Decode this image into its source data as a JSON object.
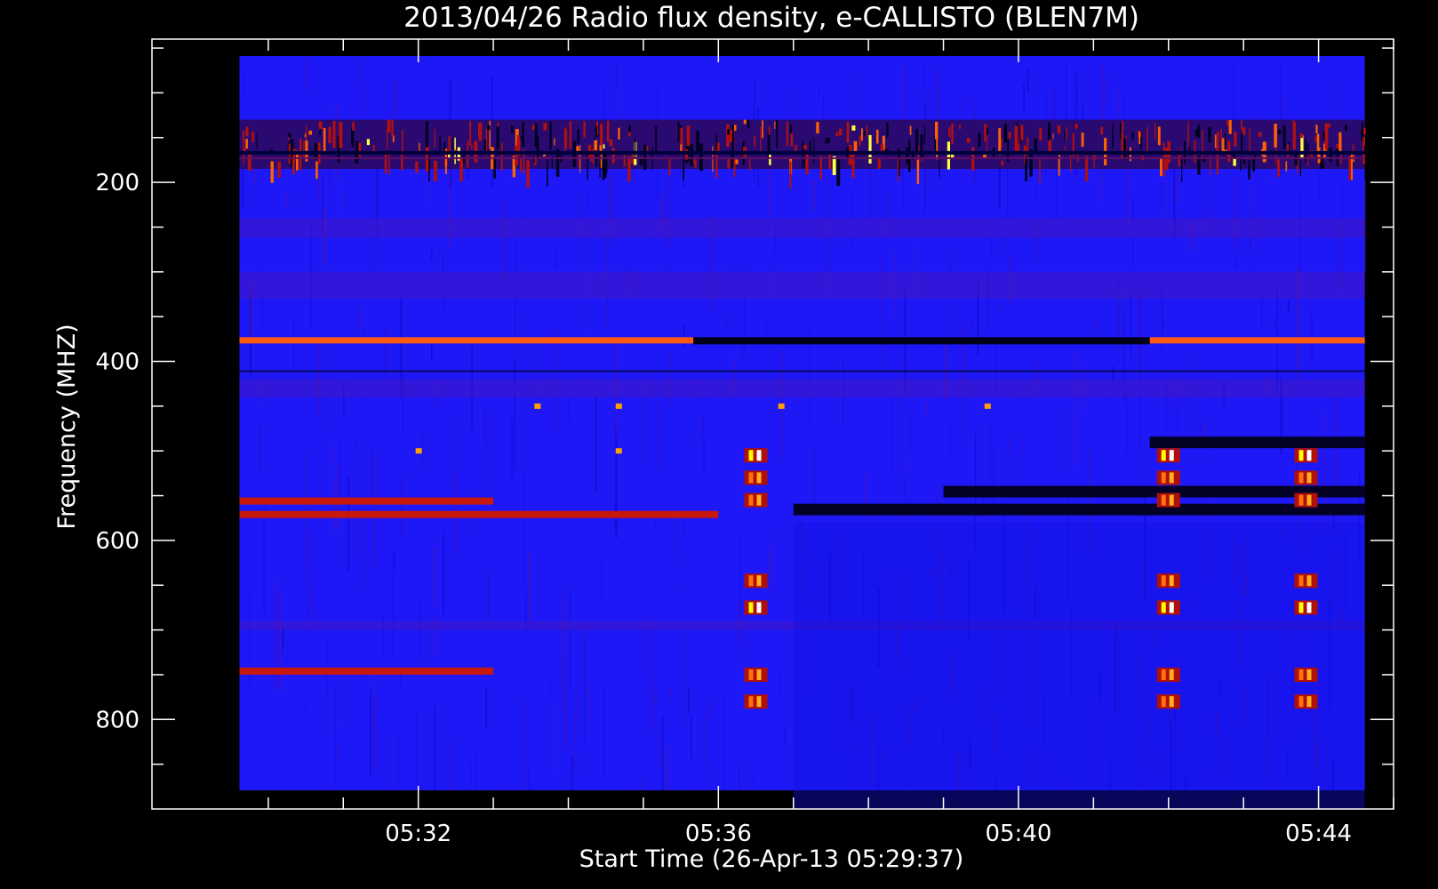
{
  "chart_data": {
    "type": "heatmap",
    "title": "2013/04/26  Radio flux density, e-CALLISTO (BLEN7M)",
    "xlabel": "Start Time (26-Apr-13 05:29:37)",
    "ylabel": "Frequency (MHZ)",
    "x_unit": "UT",
    "x_range": [
      "05:29:37",
      "05:44:37"
    ],
    "xlim": [
      "05:28:27",
      "05:45:00"
    ],
    "ylim": [
      40,
      900
    ],
    "y_axis_inverted": true,
    "xticks_major": [
      "05:32",
      "05:36",
      "05:40",
      "05:44"
    ],
    "yticks_major": [
      200,
      400,
      600,
      800
    ],
    "grid": false,
    "colormap": "blue-red-yellow-white",
    "colors": {
      "background": "#000000",
      "axes": "#ffffff",
      "low_intensity": "#0000c8",
      "medium_intensity": "#c80000",
      "high_intensity": "#ffff00",
      "peak_intensity": "#ffffff",
      "absorption": "#000010"
    },
    "features": {
      "rfi_band_mhz": [
        130,
        185
      ],
      "bright_lines": [
        {
          "freq_mhz": 376,
          "segments": [
            [
              "05:29:37",
              "05:35:40"
            ],
            [
              "05:41:45",
              "05:44:37"
            ]
          ],
          "level": "high"
        },
        {
          "freq_mhz": 376,
          "segments": [
            [
              "05:35:40",
              "05:41:45"
            ]
          ],
          "level": "absorption"
        },
        {
          "freq_mhz": 570,
          "segments": [
            [
              "05:29:37",
              "05:36:00"
            ]
          ],
          "level": "medium"
        },
        {
          "freq_mhz": 745,
          "segments": [
            [
              "05:29:37",
              "05:33:00"
            ]
          ],
          "level": "medium"
        },
        {
          "freq_mhz": 555,
          "segments": [
            [
              "05:29:37",
              "05:33:00"
            ]
          ],
          "level": "medium"
        }
      ],
      "absorption_bands": [
        {
          "freq_mhz": 565,
          "segments": [
            [
              "05:37:00",
              "05:44:37"
            ]
          ]
        },
        {
          "freq_mhz": 545,
          "segments": [
            [
              "05:39:00",
              "05:44:37"
            ]
          ]
        },
        {
          "freq_mhz": 490,
          "segments": [
            [
              "05:41:45",
              "05:44:37"
            ]
          ]
        }
      ],
      "pulse_groups": [
        {
          "time": "05:36:30",
          "freqs_mhz": [
            505,
            530,
            555,
            645,
            675,
            750,
            780
          ]
        },
        {
          "time": "05:42:00",
          "freqs_mhz": [
            505,
            530,
            555,
            645,
            675,
            750,
            780
          ]
        },
        {
          "time": "05:43:50",
          "freqs_mhz": [
            505,
            530,
            555,
            645,
            675,
            750,
            780
          ]
        }
      ]
    }
  }
}
